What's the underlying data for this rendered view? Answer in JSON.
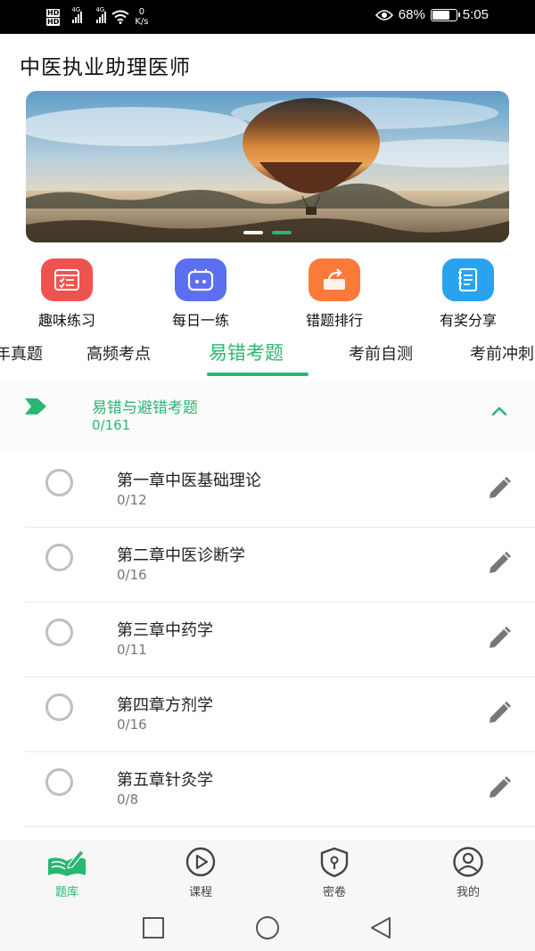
{
  "status_bar": {
    "hd1": "HD",
    "hd2": "HD",
    "net1": "4G",
    "net2": "4G",
    "speed_value": "0",
    "speed_unit": "K/s",
    "battery": "68%",
    "battery_level": 0.68,
    "time": "5:05"
  },
  "app": {
    "title": "中医执业助理医师"
  },
  "banner": {
    "slides": 2,
    "active_slide": 1
  },
  "quick_actions": [
    {
      "label": "趣味练习",
      "icon": "quiz-icon",
      "color": "#ef5350"
    },
    {
      "label": "每日一练",
      "icon": "daily-icon",
      "color": "#5b6ff0"
    },
    {
      "label": "错题排行",
      "icon": "ranking-icon",
      "color": "#fb7a3a"
    },
    {
      "label": "有奖分享",
      "icon": "share-icon",
      "color": "#29a3f0"
    }
  ],
  "tabs": [
    {
      "label": "年真题",
      "active": false
    },
    {
      "label": "高频考点",
      "active": false
    },
    {
      "label": "易错考题",
      "active": true
    },
    {
      "label": "考前自测",
      "active": false
    },
    {
      "label": "考前冲刺",
      "active": false
    }
  ],
  "section": {
    "title": "易错与避错考题",
    "count": "0/161"
  },
  "chapters": [
    {
      "name": "第一章中医基础理论",
      "count": "0/12"
    },
    {
      "name": "第二章中医诊断学",
      "count": "0/16"
    },
    {
      "name": "第三章中药学",
      "count": "0/11"
    },
    {
      "name": "第四章方剂学",
      "count": "0/16"
    },
    {
      "name": "第五章针灸学",
      "count": "0/8"
    }
  ],
  "bottom_nav": [
    {
      "label": "题库",
      "icon": "question-bank-icon",
      "active": true
    },
    {
      "label": "课程",
      "icon": "play-icon",
      "active": false
    },
    {
      "label": "密卷",
      "icon": "secret-paper-icon",
      "active": false
    },
    {
      "label": "我的",
      "icon": "profile-icon",
      "active": false
    }
  ],
  "colors": {
    "accent": "#2bb673"
  }
}
